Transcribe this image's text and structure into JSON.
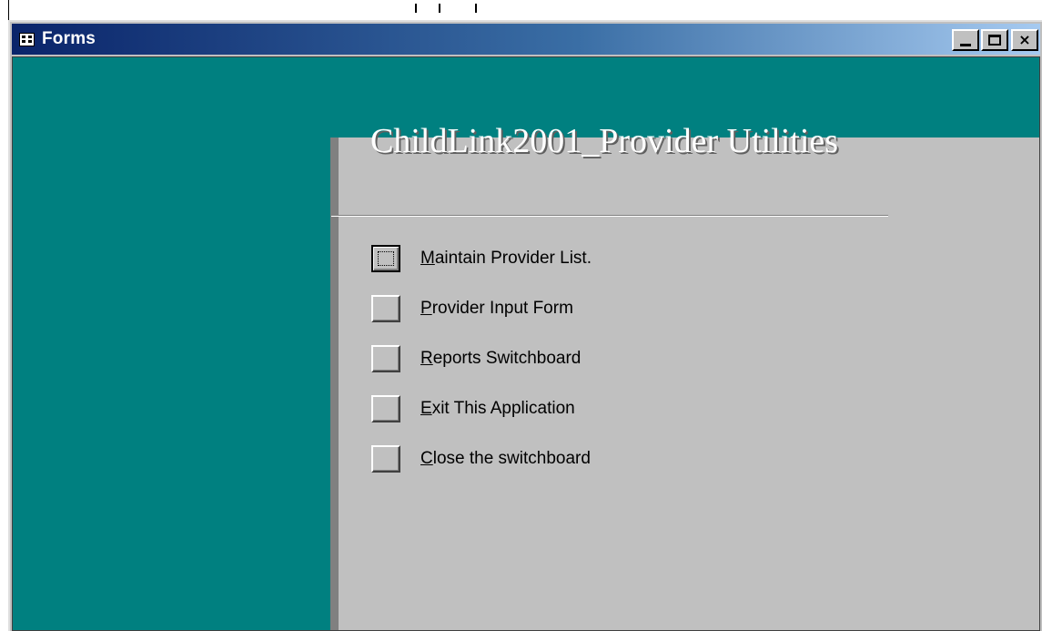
{
  "window": {
    "title": "Forms",
    "controls": {
      "minimize": "minimize",
      "maximize": "maximize",
      "close": "×"
    }
  },
  "switchboard": {
    "title": "ChildLink2001_Provider Utilities",
    "items": [
      {
        "accel": "M",
        "rest": "aintain Provider List.",
        "focused": true
      },
      {
        "accel": "P",
        "rest": "rovider Input Form",
        "focused": false
      },
      {
        "accel": "R",
        "rest": "eports Switchboard",
        "focused": false
      },
      {
        "accel": "E",
        "rest": "xit This Application",
        "focused": false
      },
      {
        "accel": "C",
        "rest": "lose the switchboard",
        "focused": false
      }
    ]
  },
  "colors": {
    "teal": "#008080",
    "panel": "#c0c0c0",
    "titlebar_start": "#0a246a",
    "titlebar_end": "#a6caf0"
  },
  "icons": {
    "window_icon": "form-icon"
  }
}
